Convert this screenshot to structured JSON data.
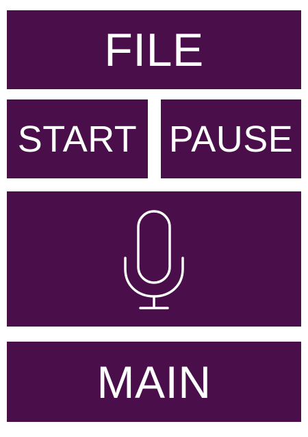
{
  "colors": {
    "tile_background": "#4a0f4a",
    "text": "#ffffff",
    "page_background": "#ffffff"
  },
  "buttons": {
    "file_label": "FILE",
    "start_label": "START",
    "pause_label": "PAUSE",
    "main_label": "MAIN"
  },
  "mic": {
    "icon": "microphone-icon"
  }
}
